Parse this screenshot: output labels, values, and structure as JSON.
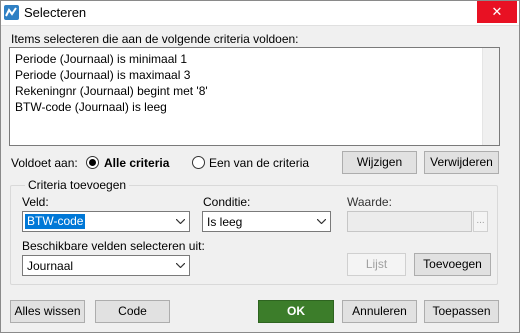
{
  "window": {
    "title": "Selecteren",
    "close_glyph": "✕",
    "icon": "app-logo-icon"
  },
  "instructions": "Items selecteren die aan de volgende criteria voldoen:",
  "criteria": [
    "Periode (Journaal) is minimaal 1",
    "Periode (Journaal) is maximaal 3",
    "Rekeningnr (Journaal) begint met '8'",
    "BTW-code (Journaal) is leeg"
  ],
  "match": {
    "label": "Voldoet aan:",
    "option_all": "Alle criteria",
    "option_any": "Een van de criteria",
    "selected": "all"
  },
  "buttons": {
    "edit": "Wijzigen",
    "delete": "Verwijderen",
    "list": "Lijst",
    "add": "Toevoegen",
    "clear_all": "Alles wissen",
    "code": "Code",
    "ok": "OK",
    "cancel": "Annuleren",
    "apply": "Toepassen",
    "ellipsis": "..."
  },
  "add_criteria": {
    "group_title": "Criteria toevoegen",
    "field_label": "Veld:",
    "field_value": "BTW-code",
    "condition_label": "Conditie:",
    "condition_value": "Is leeg",
    "value_label": "Waarde:",
    "value_value": "",
    "available_label": "Beschikbare velden selecteren uit:",
    "available_value": "Journaal"
  },
  "colors": {
    "ok_button": "#3c7d2a",
    "selection": "#0078d7",
    "close": "#e81123"
  }
}
